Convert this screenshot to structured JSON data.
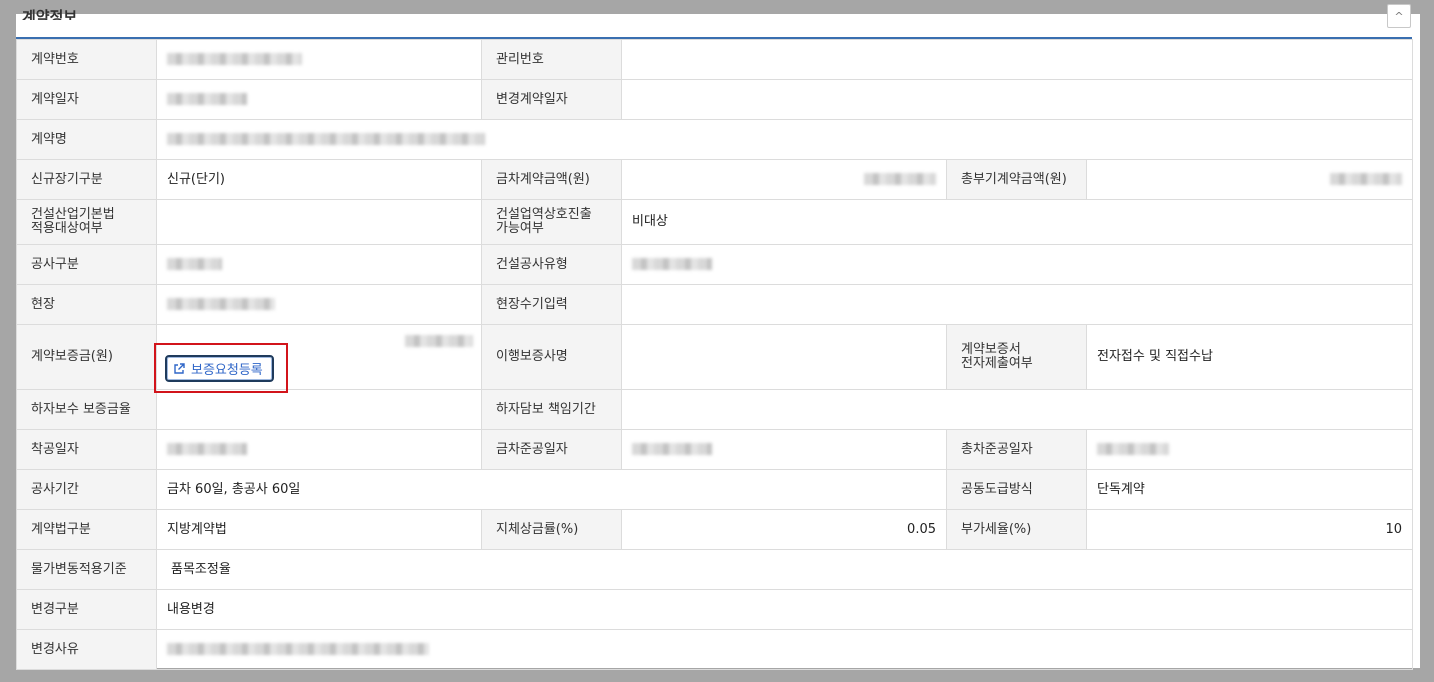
{
  "dialog": {
    "title": "계약정보",
    "close_glyph": "^"
  },
  "labels": {
    "contract_no": "계약번호",
    "mgmt_no": "관리번호",
    "contract_date": "계약일자",
    "changed_contract_date": "변경계약일자",
    "contract_name": "계약명",
    "new_long_term": "신규장기구분",
    "this_amount": "금차계약금액(원)",
    "total_amount": "총부기계약금액(원)",
    "cil_line1": "건설산업기본법",
    "cil_line2": "적용대상여부",
    "mutual_line1": "건설업역상호진출",
    "mutual_line2": "가능여부",
    "work_type": "공사구분",
    "construction_type": "건설공사유형",
    "site": "현장",
    "site_manual": "현장수기입력",
    "guarantee_amount": "계약보증금(원)",
    "performance_guarantor": "이행보증사명",
    "ecert_line1": "계약보증서",
    "ecert_line2": "전자제출여부",
    "defect_guarantee": "하자보수 보증금율",
    "defect_period": "하자담보 책임기간",
    "start_date": "착공일자",
    "this_completion": "금차준공일자",
    "total_completion": "총차준공일자",
    "work_period": "공사기간",
    "joint_method": "공동도급방식",
    "contract_law": "계약법구분",
    "delay_rate": "지체상금률(%)",
    "vat_rate": "부가세율(%)",
    "price_fluct": "물가변동적용기준",
    "change_type": "변경구분",
    "change_reason": "변경사유"
  },
  "values": {
    "new_long_term": "신규(단기)",
    "mutual_entry": "비대상",
    "ecert": "전자접수 및 직접수납",
    "work_period": "금차 60일, 총공사 60일",
    "joint_method": "단독계약",
    "contract_law": "지방계약법",
    "delay_rate": "0.05",
    "vat_rate": "10",
    "price_fluct": "품목조정율",
    "change_type": "내용변경"
  },
  "buttons": {
    "guarantee_request": "보증요청등록"
  },
  "icons": {
    "guarantee_request": "external-link-icon",
    "close": "chevron-up-icon"
  },
  "colors": {
    "accent_line": "#3a6fb0",
    "highlight_box": "#d2141b",
    "button_text": "#2f66c8"
  }
}
